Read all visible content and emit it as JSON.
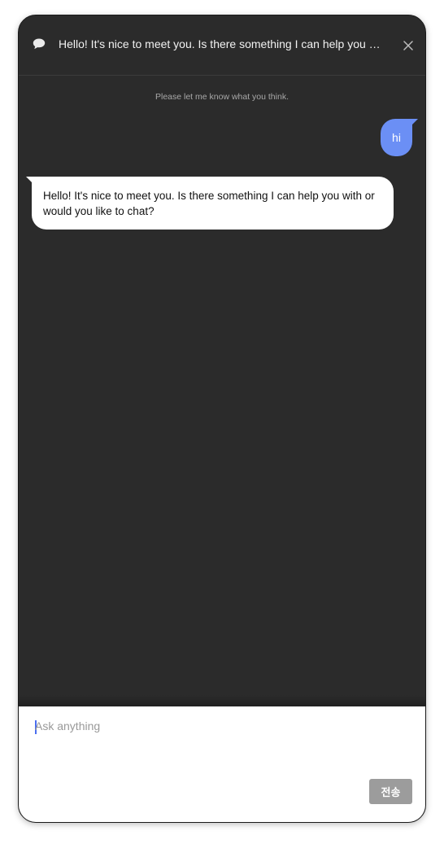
{
  "header": {
    "title": "Hello! It's nice to meet you. Is there something I can help you with or would you like to chat?",
    "icon": "chat-bubble-icon",
    "close_icon": "close-icon"
  },
  "messages": {
    "notice": "Please let me know what you think.",
    "items": [
      {
        "role": "user",
        "text": "hi"
      },
      {
        "role": "assistant",
        "text": "Hello! It's nice to meet you. Is there something I can help you with or would you like to chat?"
      }
    ]
  },
  "composer": {
    "placeholder": "Ask anything",
    "value": "",
    "send_label": "전송"
  },
  "colors": {
    "background": "#2b2b2b",
    "user_bubble": "#6b8ff5",
    "assistant_bubble": "#ffffff",
    "send_button": "#9c9c9c",
    "caret": "#4a6ef0"
  }
}
